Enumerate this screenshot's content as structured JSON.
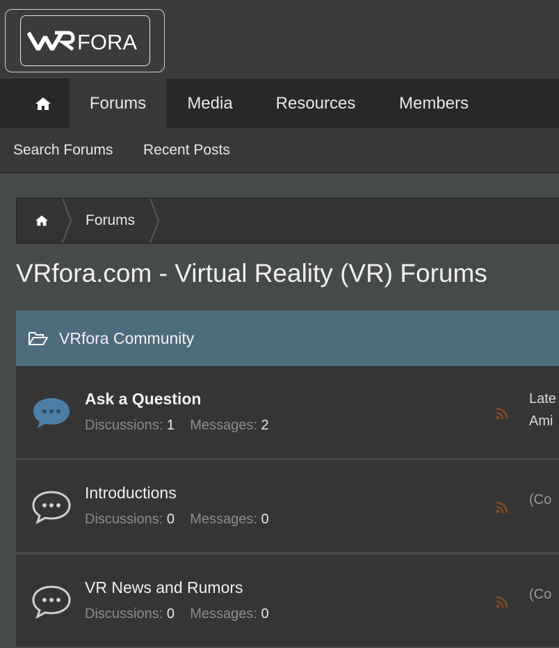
{
  "logo": {
    "brand_left": "VR",
    "brand_right": "FORA"
  },
  "nav": {
    "home_icon": "home-icon",
    "items": [
      {
        "label": "Forums",
        "active": true
      },
      {
        "label": "Media"
      },
      {
        "label": "Resources"
      },
      {
        "label": "Members"
      }
    ]
  },
  "subnav": {
    "items": [
      {
        "label": "Search Forums"
      },
      {
        "label": "Recent Posts"
      }
    ]
  },
  "breadcrumb": {
    "home_icon": "home-icon",
    "items": [
      {
        "label": "Forums"
      }
    ]
  },
  "page_title": "VRfora.com - Virtual Reality (VR) Forums",
  "category": {
    "icon": "folder-open-icon",
    "title": "VRfora Community",
    "color": "#4f6b7e"
  },
  "forums": [
    {
      "title": "Ask a Question",
      "has_unread": true,
      "discussions_label": "Discussions:",
      "discussions": "1",
      "messages_label": "Messages:",
      "messages": "2",
      "latest_line1": "Late",
      "latest_line2": "Ami"
    },
    {
      "title": "Introductions",
      "has_unread": false,
      "discussions_label": "Discussions:",
      "discussions": "0",
      "messages_label": "Messages:",
      "messages": "0",
      "latest_line1": "(Co"
    },
    {
      "title": "VR News and Rumors",
      "has_unread": false,
      "discussions_label": "Discussions:",
      "discussions": "0",
      "messages_label": "Messages:",
      "messages": "0",
      "latest_line1": "(Co"
    }
  ],
  "colors": {
    "rss": "#8a4a22",
    "unread_icon": "#4d7fa6",
    "read_icon": "#d0d0d0"
  }
}
